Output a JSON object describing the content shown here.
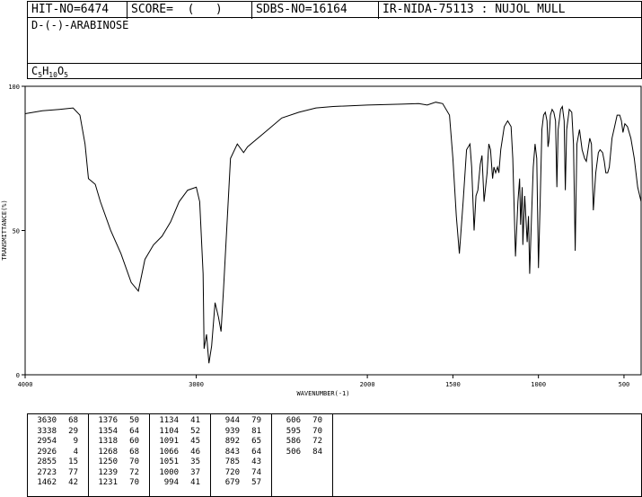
{
  "header": {
    "hit_no": "HIT-NO=6474",
    "score": "SCORE=  (   )",
    "sdbs_no": "SDBS-NO=16164",
    "ir_nida": "IR-NIDA-75113 : NUJOL MULL"
  },
  "compound": {
    "name": "D-(-)-ARABINOSE",
    "formula_parts": [
      {
        "t": "C",
        "sub": false
      },
      {
        "t": "5",
        "sub": true
      },
      {
        "t": "H",
        "sub": false
      },
      {
        "t": "10",
        "sub": true
      },
      {
        "t": "O",
        "sub": false
      },
      {
        "t": "5",
        "sub": true
      }
    ]
  },
  "chart_data": {
    "type": "line",
    "xlabel": "WAVENUMBER(-1)",
    "ylabel": "TRANSMITTANCE(%)",
    "xlim": [
      4000,
      400
    ],
    "ylim": [
      0,
      100
    ],
    "x_ticks": [
      4000,
      3000,
      2000,
      1500,
      1000,
      500
    ],
    "x_tick_labels": [
      "4000",
      "3000",
      "2000",
      "1500",
      "1000",
      "500"
    ],
    "y_ticks": [
      0,
      50,
      100
    ],
    "y_tick_labels": [
      "0",
      "50",
      "100"
    ],
    "series": [
      {
        "points": [
          [
            4000,
            90.5
          ],
          [
            3900,
            91.5
          ],
          [
            3800,
            92
          ],
          [
            3720,
            92.5
          ],
          [
            3680,
            90
          ],
          [
            3650,
            80
          ],
          [
            3630,
            68
          ],
          [
            3610,
            67
          ],
          [
            3590,
            66
          ],
          [
            3560,
            60
          ],
          [
            3500,
            50
          ],
          [
            3440,
            42
          ],
          [
            3380,
            32
          ],
          [
            3338,
            29
          ],
          [
            3300,
            40
          ],
          [
            3250,
            45
          ],
          [
            3200,
            48
          ],
          [
            3150,
            53
          ],
          [
            3100,
            60
          ],
          [
            3050,
            64
          ],
          [
            3000,
            65
          ],
          [
            2980,
            60
          ],
          [
            2960,
            35
          ],
          [
            2954,
            9
          ],
          [
            2940,
            14
          ],
          [
            2926,
            4
          ],
          [
            2910,
            10
          ],
          [
            2890,
            25
          ],
          [
            2870,
            20
          ],
          [
            2855,
            15
          ],
          [
            2840,
            30
          ],
          [
            2800,
            75
          ],
          [
            2760,
            80
          ],
          [
            2723,
            77
          ],
          [
            2700,
            79
          ],
          [
            2600,
            84
          ],
          [
            2500,
            89
          ],
          [
            2400,
            91
          ],
          [
            2300,
            92.5
          ],
          [
            2200,
            93
          ],
          [
            2000,
            93.5
          ],
          [
            1800,
            93.8
          ],
          [
            1700,
            94
          ],
          [
            1650,
            93.5
          ],
          [
            1600,
            94.5
          ],
          [
            1560,
            94
          ],
          [
            1520,
            90
          ],
          [
            1500,
            75
          ],
          [
            1480,
            55
          ],
          [
            1462,
            42
          ],
          [
            1440,
            60
          ],
          [
            1420,
            78
          ],
          [
            1400,
            80
          ],
          [
            1390,
            72
          ],
          [
            1376,
            50
          ],
          [
            1365,
            62
          ],
          [
            1354,
            64
          ],
          [
            1340,
            73
          ],
          [
            1330,
            76
          ],
          [
            1318,
            60
          ],
          [
            1300,
            70
          ],
          [
            1290,
            80
          ],
          [
            1280,
            78
          ],
          [
            1268,
            68
          ],
          [
            1260,
            72
          ],
          [
            1250,
            70
          ],
          [
            1239,
            72
          ],
          [
            1231,
            70
          ],
          [
            1220,
            78
          ],
          [
            1200,
            86
          ],
          [
            1180,
            88
          ],
          [
            1160,
            86
          ],
          [
            1150,
            75
          ],
          [
            1134,
            41
          ],
          [
            1120,
            60
          ],
          [
            1110,
            68
          ],
          [
            1104,
            52
          ],
          [
            1095,
            65
          ],
          [
            1091,
            45
          ],
          [
            1080,
            62
          ],
          [
            1066,
            46
          ],
          [
            1058,
            55
          ],
          [
            1051,
            35
          ],
          [
            1040,
            55
          ],
          [
            1030,
            72
          ],
          [
            1020,
            80
          ],
          [
            1010,
            75
          ],
          [
            1000,
            37
          ],
          [
            990,
            60
          ],
          [
            980,
            85
          ],
          [
            970,
            90
          ],
          [
            960,
            91
          ],
          [
            950,
            88
          ],
          [
            944,
            79
          ],
          [
            939,
            81
          ],
          [
            930,
            90
          ],
          [
            920,
            92
          ],
          [
            910,
            91
          ],
          [
            900,
            88
          ],
          [
            892,
            65
          ],
          [
            885,
            85
          ],
          [
            870,
            92
          ],
          [
            860,
            93
          ],
          [
            850,
            88
          ],
          [
            843,
            64
          ],
          [
            835,
            85
          ],
          [
            820,
            92
          ],
          [
            805,
            91
          ],
          [
            795,
            80
          ],
          [
            785,
            43
          ],
          [
            775,
            80
          ],
          [
            760,
            85
          ],
          [
            745,
            78
          ],
          [
            730,
            75
          ],
          [
            720,
            74
          ],
          [
            700,
            82
          ],
          [
            690,
            80
          ],
          [
            679,
            57
          ],
          [
            665,
            70
          ],
          [
            650,
            77
          ],
          [
            640,
            78
          ],
          [
            625,
            77
          ],
          [
            615,
            74
          ],
          [
            606,
            70
          ],
          [
            595,
            70
          ],
          [
            586,
            72
          ],
          [
            570,
            82
          ],
          [
            555,
            86
          ],
          [
            540,
            90
          ],
          [
            525,
            90
          ],
          [
            515,
            88
          ],
          [
            506,
            84
          ],
          [
            495,
            87
          ],
          [
            480,
            86
          ],
          [
            460,
            82
          ],
          [
            440,
            75
          ],
          [
            420,
            65
          ],
          [
            400,
            60
          ]
        ]
      }
    ]
  },
  "peak_table": [
    [
      [
        "3630",
        "68"
      ],
      [
        "3338",
        "29"
      ],
      [
        "2954",
        "9"
      ],
      [
        "2926",
        "4"
      ],
      [
        "2855",
        "15"
      ],
      [
        "2723",
        "77"
      ],
      [
        "1462",
        "42"
      ]
    ],
    [
      [
        "1376",
        "50"
      ],
      [
        "1354",
        "64"
      ],
      [
        "1318",
        "60"
      ],
      [
        "1268",
        "68"
      ],
      [
        "1250",
        "70"
      ],
      [
        "1239",
        "72"
      ],
      [
        "1231",
        "70"
      ]
    ],
    [
      [
        "1134",
        "41"
      ],
      [
        "1104",
        "52"
      ],
      [
        "1091",
        "45"
      ],
      [
        "1066",
        "46"
      ],
      [
        "1051",
        "35"
      ],
      [
        "1000",
        "37"
      ],
      [
        "994",
        "41"
      ]
    ],
    [
      [
        "944",
        "79"
      ],
      [
        "939",
        "81"
      ],
      [
        "892",
        "65"
      ],
      [
        "843",
        "64"
      ],
      [
        "785",
        "43"
      ],
      [
        "720",
        "74"
      ],
      [
        "679",
        "57"
      ]
    ],
    [
      [
        "606",
        "70"
      ],
      [
        "595",
        "70"
      ],
      [
        "586",
        "72"
      ],
      [
        "506",
        "84"
      ]
    ]
  ]
}
